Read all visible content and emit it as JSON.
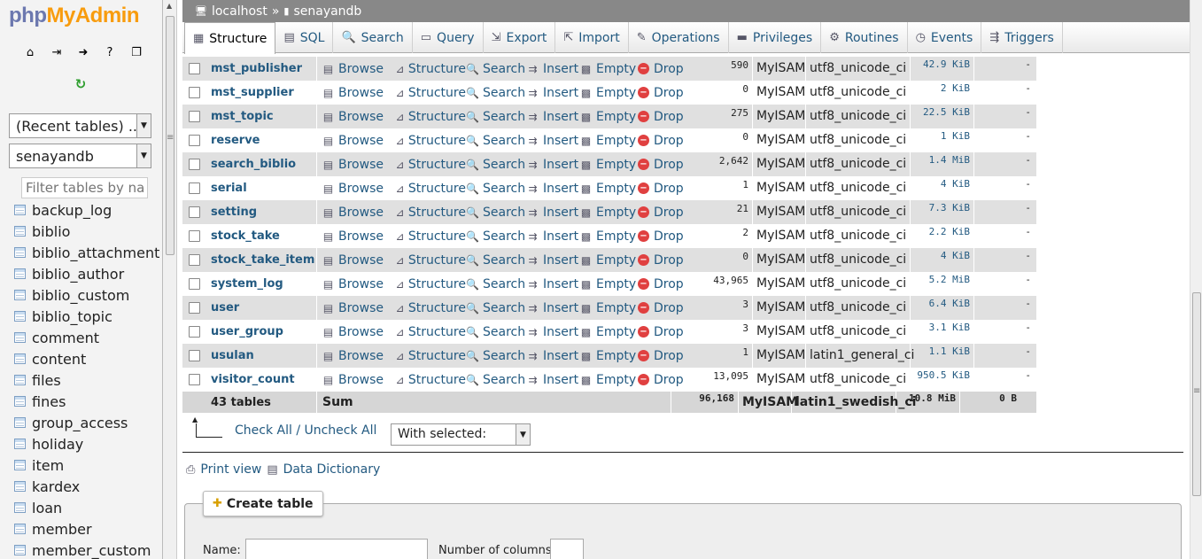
{
  "logo": {
    "php": "php",
    "admin": "MyAdmin"
  },
  "nav_icons": [
    {
      "name": "home-icon",
      "glyph": "⌂"
    },
    {
      "name": "exit-icon",
      "glyph": "⇥"
    },
    {
      "name": "query-window-icon",
      "glyph": "➜"
    },
    {
      "name": "docs-icon",
      "glyph": "?"
    },
    {
      "name": "copy-icon",
      "glyph": "❐"
    }
  ],
  "recent_select": "(Recent tables) ...",
  "db_select": "senayandb",
  "filter_placeholder": "Filter tables by name",
  "sidebar_tables": [
    "backup_log",
    "biblio",
    "biblio_attachment",
    "biblio_author",
    "biblio_custom",
    "biblio_topic",
    "comment",
    "content",
    "files",
    "fines",
    "group_access",
    "holiday",
    "item",
    "kardex",
    "loan",
    "member",
    "member_custom"
  ],
  "breadcrumb": {
    "server": "localhost",
    "sep": "»",
    "database": "senayandb"
  },
  "tabs": [
    {
      "label": "Structure",
      "icon": "▦"
    },
    {
      "label": "SQL",
      "icon": "▤"
    },
    {
      "label": "Search",
      "icon": "🔍"
    },
    {
      "label": "Query",
      "icon": "▭"
    },
    {
      "label": "Export",
      "icon": "⇲"
    },
    {
      "label": "Import",
      "icon": "⇱"
    },
    {
      "label": "Operations",
      "icon": "✎"
    },
    {
      "label": "Privileges",
      "icon": "▬"
    },
    {
      "label": "Routines",
      "icon": "⚙"
    },
    {
      "label": "Events",
      "icon": "◷"
    },
    {
      "label": "Triggers",
      "icon": "⇶"
    }
  ],
  "actions": {
    "browse": "Browse",
    "structure": "Structure",
    "search": "Search",
    "insert": "Insert",
    "empty": "Empty",
    "drop": "Drop"
  },
  "rows": [
    {
      "name": "mst_publisher",
      "rows": "590",
      "engine": "MyISAM",
      "collation": "utf8_unicode_ci",
      "size": "42.9 KiB",
      "overhead": "-"
    },
    {
      "name": "mst_supplier",
      "rows": "0",
      "engine": "MyISAM",
      "collation": "utf8_unicode_ci",
      "size": "2 KiB",
      "overhead": "-"
    },
    {
      "name": "mst_topic",
      "rows": "275",
      "engine": "MyISAM",
      "collation": "utf8_unicode_ci",
      "size": "22.5 KiB",
      "overhead": "-"
    },
    {
      "name": "reserve",
      "rows": "0",
      "engine": "MyISAM",
      "collation": "utf8_unicode_ci",
      "size": "1 KiB",
      "overhead": "-"
    },
    {
      "name": "search_biblio",
      "rows": "2,642",
      "engine": "MyISAM",
      "collation": "utf8_unicode_ci",
      "size": "1.4 MiB",
      "overhead": "-"
    },
    {
      "name": "serial",
      "rows": "1",
      "engine": "MyISAM",
      "collation": "utf8_unicode_ci",
      "size": "4 KiB",
      "overhead": "-"
    },
    {
      "name": "setting",
      "rows": "21",
      "engine": "MyISAM",
      "collation": "utf8_unicode_ci",
      "size": "7.3 KiB",
      "overhead": "-"
    },
    {
      "name": "stock_take",
      "rows": "2",
      "engine": "MyISAM",
      "collation": "utf8_unicode_ci",
      "size": "2.2 KiB",
      "overhead": "-"
    },
    {
      "name": "stock_take_item",
      "rows": "0",
      "engine": "MyISAM",
      "collation": "utf8_unicode_ci",
      "size": "4 KiB",
      "overhead": "-"
    },
    {
      "name": "system_log",
      "rows": "43,965",
      "engine": "MyISAM",
      "collation": "utf8_unicode_ci",
      "size": "5.2 MiB",
      "overhead": "-"
    },
    {
      "name": "user",
      "rows": "3",
      "engine": "MyISAM",
      "collation": "utf8_unicode_ci",
      "size": "6.4 KiB",
      "overhead": "-"
    },
    {
      "name": "user_group",
      "rows": "3",
      "engine": "MyISAM",
      "collation": "utf8_unicode_ci",
      "size": "3.1 KiB",
      "overhead": "-"
    },
    {
      "name": "usulan",
      "rows": "1",
      "engine": "MyISAM",
      "collation": "latin1_general_ci",
      "size": "1.1 KiB",
      "overhead": "-"
    },
    {
      "name": "visitor_count",
      "rows": "13,095",
      "engine": "MyISAM",
      "collation": "utf8_unicode_ci",
      "size": "950.5 KiB",
      "overhead": "-"
    }
  ],
  "footer": {
    "tables": "43 tables",
    "sum": "Sum",
    "rows": "96,168",
    "engine": "MyISAM",
    "collation": "latin1_swedish_ci",
    "size": "10.8 MiB",
    "overhead": "0 B"
  },
  "check_all": "Check All / Uncheck All",
  "with_selected": "With selected:",
  "print_view": "Print view",
  "data_dictionary": "Data Dictionary",
  "create_table": "Create table",
  "name_label": "Name:",
  "columns_label": "Number of columns:"
}
